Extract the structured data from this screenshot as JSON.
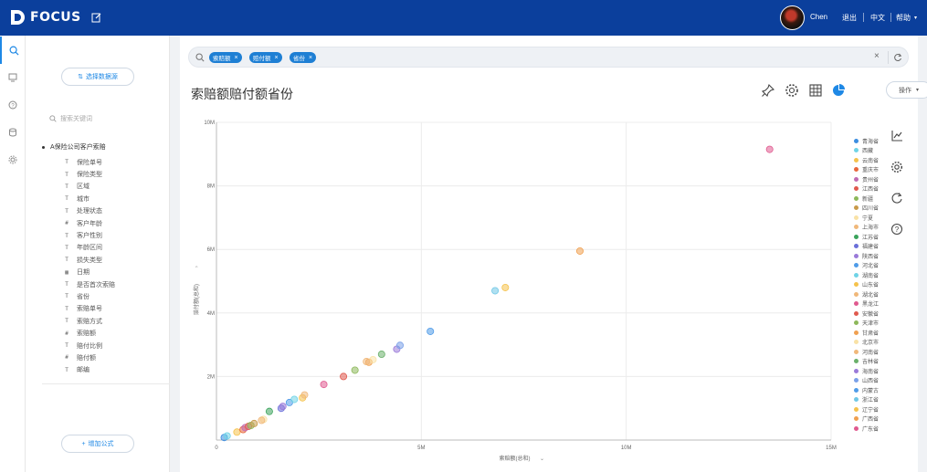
{
  "topbar": {
    "logo_text": "FOCUS",
    "user_name": "Chen",
    "links": [
      "退出",
      "中文",
      "帮助"
    ]
  },
  "rail": {
    "items": [
      {
        "icon": "search-icon",
        "active": true
      },
      {
        "icon": "dashboard-icon",
        "active": false
      },
      {
        "icon": "help-icon",
        "active": false
      },
      {
        "icon": "database-icon",
        "active": false
      },
      {
        "icon": "gear-icon",
        "active": false
      }
    ]
  },
  "panel": {
    "select_source_label": "选择数据源",
    "search_placeholder": "搜索关键词",
    "root_label": "A保险公司客户索赔",
    "fields": [
      {
        "icon": "text-field-icon",
        "label": "保险单号"
      },
      {
        "icon": "text-field-icon",
        "label": "保险类型"
      },
      {
        "icon": "text-field-icon",
        "label": "区域"
      },
      {
        "icon": "text-field-icon",
        "label": "城市"
      },
      {
        "icon": "text-field-icon",
        "label": "处理状态"
      },
      {
        "icon": "number-field-icon",
        "label": "客户年龄"
      },
      {
        "icon": "text-field-icon",
        "label": "客户性别"
      },
      {
        "icon": "text-field-icon",
        "label": "年龄区间"
      },
      {
        "icon": "text-field-icon",
        "label": "损失类型"
      },
      {
        "icon": "date-field-icon",
        "label": "日期"
      },
      {
        "icon": "text-field-icon",
        "label": "是否首次索赔"
      },
      {
        "icon": "text-field-icon",
        "label": "省份"
      },
      {
        "icon": "text-field-icon",
        "label": "索赔单号"
      },
      {
        "icon": "text-field-icon",
        "label": "索赔方式"
      },
      {
        "icon": "number-field-icon",
        "label": "索赔额"
      },
      {
        "icon": "text-field-icon",
        "label": "赔付比例"
      },
      {
        "icon": "number-field-icon",
        "label": "赔付额"
      },
      {
        "icon": "text-field-icon",
        "label": "邮编"
      }
    ],
    "add_formula_label": "增加公式"
  },
  "main": {
    "search_tags": [
      "索赔额",
      "赔付额",
      "省份"
    ],
    "title": "索赔额赔付额省份",
    "operate_label": "操作"
  },
  "colors": {
    "brand": "#0b3f9c",
    "accent": "#1e88e5"
  },
  "chart_data": {
    "type": "scatter",
    "title": "",
    "xlabel": "索赔额(总和)",
    "ylabel": "赔付额(总和)",
    "xlim": [
      0,
      15000000
    ],
    "ylim": [
      0,
      10000000
    ],
    "x_ticks": [
      {
        "value": 0,
        "label": "0"
      },
      {
        "value": 5000000,
        "label": "5M"
      },
      {
        "value": 10000000,
        "label": "10M"
      },
      {
        "value": 15000000,
        "label": "15M"
      }
    ],
    "y_ticks": [
      {
        "value": 2000000,
        "label": "2M"
      },
      {
        "value": 4000000,
        "label": "4M"
      },
      {
        "value": 6000000,
        "label": "6M"
      },
      {
        "value": 8000000,
        "label": "8M"
      },
      {
        "value": 10000000,
        "label": "10M"
      }
    ],
    "grid": true,
    "legend_position": "right",
    "series": [
      {
        "name": "青海省",
        "color": "#3b8de0",
        "x": 190000,
        "y": 80000
      },
      {
        "name": "西藏",
        "color": "#6fd3e6",
        "x": 260000,
        "y": 130000
      },
      {
        "name": "云南省",
        "color": "#f5c24c",
        "x": 500000,
        "y": 250000
      },
      {
        "name": "重庆市",
        "color": "#e8663b",
        "x": 650000,
        "y": 330000
      },
      {
        "name": "贵州省",
        "color": "#c06bb4",
        "x": 700000,
        "y": 390000
      },
      {
        "name": "江西省",
        "color": "#e05a4f",
        "x": 780000,
        "y": 430000
      },
      {
        "name": "新疆",
        "color": "#8db85a",
        "x": 840000,
        "y": 460000
      },
      {
        "name": "四川省",
        "color": "#c89a4a",
        "x": 920000,
        "y": 520000
      },
      {
        "name": "宁夏",
        "color": "#f9e2a6",
        "x": 1150000,
        "y": 650000
      },
      {
        "name": "上海市",
        "color": "#f0b87a",
        "x": 1100000,
        "y": 620000
      },
      {
        "name": "江苏省",
        "color": "#3aa35b",
        "x": 1290000,
        "y": 900000
      },
      {
        "name": "福建省",
        "color": "#6a6fd9",
        "x": 1580000,
        "y": 1000000
      },
      {
        "name": "陕西省",
        "color": "#9a7ad9",
        "x": 1620000,
        "y": 1060000
      },
      {
        "name": "河北省",
        "color": "#4f9be8",
        "x": 1780000,
        "y": 1180000
      },
      {
        "name": "湖南省",
        "color": "#6fd3e6",
        "x": 1900000,
        "y": 1280000
      },
      {
        "name": "山东省",
        "color": "#f5c24c",
        "x": 2100000,
        "y": 1330000
      },
      {
        "name": "湖北省",
        "color": "#f0b87a",
        "x": 2150000,
        "y": 1420000
      },
      {
        "name": "黑龙江",
        "color": "#e05a8f",
        "x": 2620000,
        "y": 1750000
      },
      {
        "name": "安徽省",
        "color": "#e05a4f",
        "x": 3100000,
        "y": 2000000
      },
      {
        "name": "天津市",
        "color": "#8db85a",
        "x": 3380000,
        "y": 2200000
      },
      {
        "name": "甘肃省",
        "color": "#f0a050",
        "x": 3720000,
        "y": 2450000
      },
      {
        "name": "北京市",
        "color": "#f9e2a6",
        "x": 3820000,
        "y": 2530000
      },
      {
        "name": "河南省",
        "color": "#f0b87a",
        "x": 3660000,
        "y": 2470000
      },
      {
        "name": "吉林省",
        "color": "#6ab06a",
        "x": 4030000,
        "y": 2700000
      },
      {
        "name": "海南省",
        "color": "#9a7ad9",
        "x": 4400000,
        "y": 2860000
      },
      {
        "name": "山西省",
        "color": "#7aa0e8",
        "x": 4480000,
        "y": 2980000
      },
      {
        "name": "内蒙古",
        "color": "#4f9be8",
        "x": 5220000,
        "y": 3420000
      },
      {
        "name": "浙江省",
        "color": "#6fc7e6",
        "x": 6800000,
        "y": 4700000
      },
      {
        "name": "辽宁省",
        "color": "#f5c24c",
        "x": 7050000,
        "y": 4800000
      },
      {
        "name": "广西省",
        "color": "#f0a050",
        "x": 8870000,
        "y": 5950000
      },
      {
        "name": "广东省",
        "color": "#e05a8f",
        "x": 13500000,
        "y": 9150000
      }
    ]
  }
}
